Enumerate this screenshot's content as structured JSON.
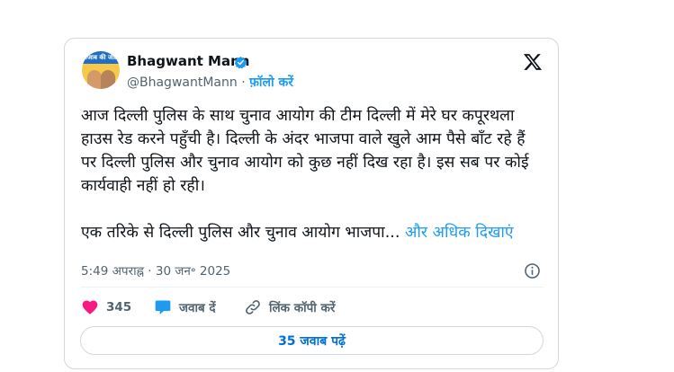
{
  "author": {
    "display_name": "Bhagwant Mann",
    "handle": "@BhagwantMann",
    "separator": "·",
    "follow_label": "फ़ॉलो करें",
    "avatar_text": "पंजाब की जीत"
  },
  "tweet": {
    "paragraph1": "आज दिल्ली पुलिस के साथ चुनाव आयोग की टीम दिल्ली में मेरे घर कपूरथला हाउस रेड करने पहुँची है। दिल्ली के अंदर भाजपा वाले खुले आम पैसे बाँट रहे हैं पर दिल्ली पुलिस और चुनाव आयोग को कुछ नहीं दिख रहा है। इस सब पर कोई कार्यवाही नहीं हो रही।",
    "paragraph2": "एक तरिके से दिल्ली पुलिस और चुनाव आयोग भाजपा...",
    "show_more": "और अधिक दिखाएं",
    "timestamp": "5:49 अपराह्न · 30 जन॰ 2025"
  },
  "actions": {
    "like_count": "345",
    "reply_label": "जवाब दें",
    "copy_link_label": "लिंक कॉपी करें"
  },
  "replies_button": "35 जवाब पढ़ें",
  "colors": {
    "accent": "#1d9bf0",
    "like": "#f91880",
    "replies_text": "#006fd6",
    "border": "#cfd9de"
  },
  "icons": {
    "verified": "verified-badge-icon",
    "logo": "x-logo-icon",
    "info": "info-icon",
    "like": "heart-icon",
    "reply": "speech-bubble-icon",
    "copy": "link-icon"
  }
}
